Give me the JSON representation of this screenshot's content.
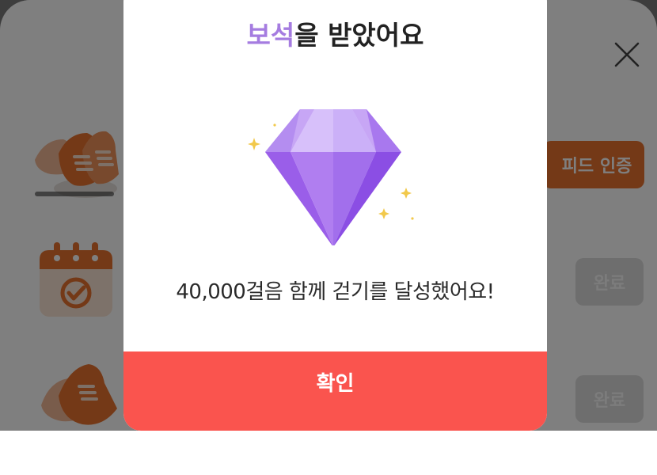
{
  "background": {
    "feed_button_label": "피드 인증",
    "done_button_1_label": "완료",
    "done_button_2_label": "완료"
  },
  "modal": {
    "title_accent": "보석",
    "title_rest": "을 받았어요",
    "message": "40,000걸음 함께 걷기를 달성했어요!",
    "confirm_label": "확인"
  },
  "icons": [
    "close-icon",
    "shoes-icon",
    "calendar-check-icon",
    "shoe-icon",
    "gem-icon"
  ],
  "colors": {
    "accent_purple": "#a57ce0",
    "confirm_red": "#fa544e",
    "feed_orange": "#e8722e"
  }
}
